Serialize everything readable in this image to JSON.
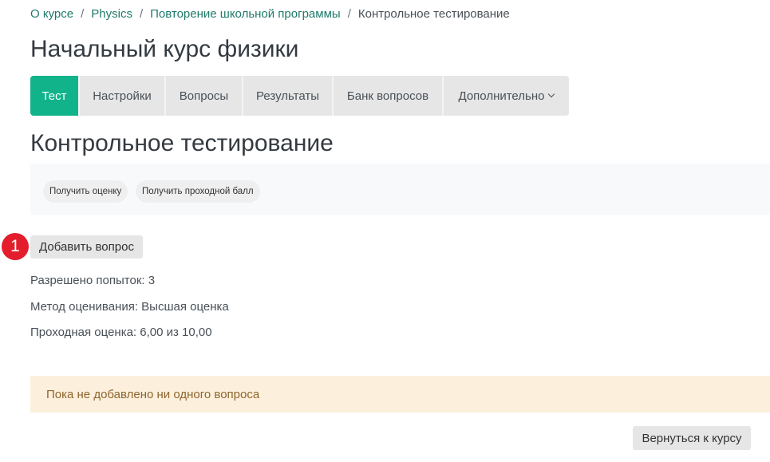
{
  "breadcrumb": {
    "items": [
      "О курсе",
      "Physics",
      "Повторение школьной программы"
    ],
    "current": "Контрольное тестирование",
    "separator": "/"
  },
  "page_title": "Начальный курс физики",
  "tabs": [
    {
      "label": "Тест",
      "active": true
    },
    {
      "label": "Настройки",
      "active": false
    },
    {
      "label": "Вопросы",
      "active": false
    },
    {
      "label": "Результаты",
      "active": false
    },
    {
      "label": "Банк вопросов",
      "active": false
    },
    {
      "label": "Дополнительно",
      "active": false,
      "dropdown": true
    }
  ],
  "section_title": "Контрольное тестирование",
  "actions": {
    "get_grade": "Получить оценку",
    "get_passing_grade": "Получить проходной балл"
  },
  "annotation_badge": "1",
  "add_question_button": "Добавить вопрос",
  "info": {
    "attempts": "Разрешено попыток: 3",
    "grading_method": "Метод оценивания: Высшая оценка",
    "passing_grade": "Проходная оценка: 6,00 из 10,00"
  },
  "alert_text": "Пока не добавлено ни одного вопроса",
  "back_button": "Вернуться к курсу",
  "colors": {
    "accent": "#11b48a",
    "link": "#1f7a6a",
    "badge": "#e31d2b",
    "alert_bg": "#fcefdc",
    "alert_text": "#8e662e"
  }
}
